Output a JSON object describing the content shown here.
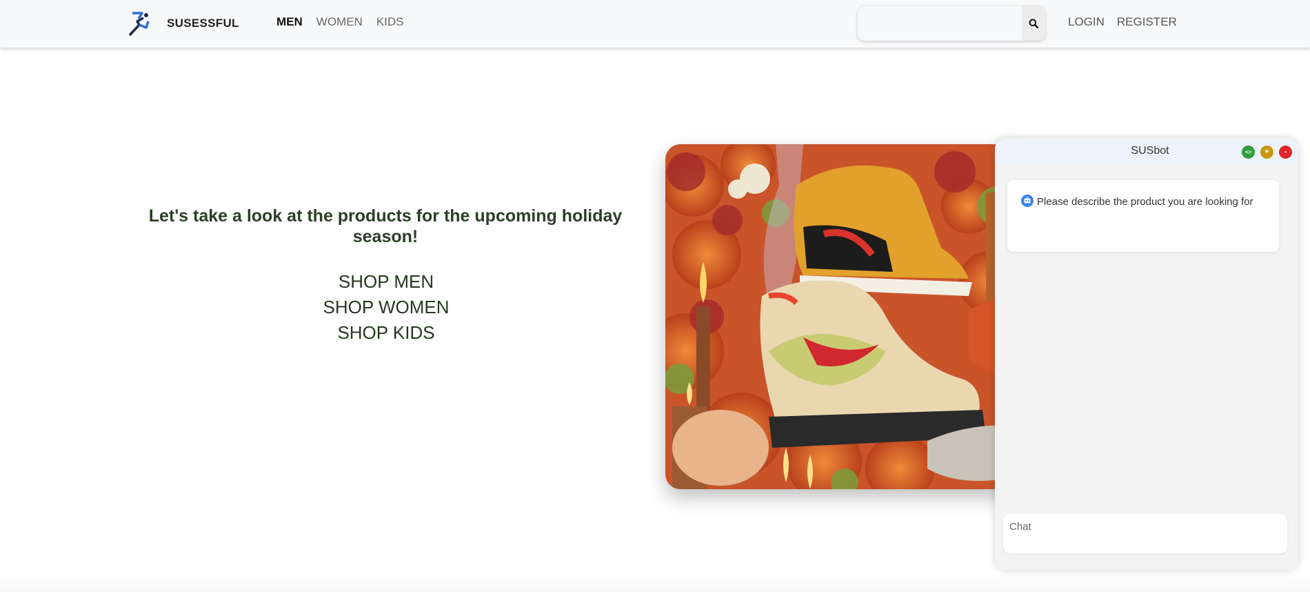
{
  "brand": {
    "name": "SUSESSFUL",
    "logo_icon": "runner-logo-icon"
  },
  "nav": {
    "links": [
      {
        "label": "MEN",
        "active": true
      },
      {
        "label": "WOMEN",
        "active": false
      },
      {
        "label": "KIDS",
        "active": false
      }
    ]
  },
  "search": {
    "value": "",
    "icon": "search-icon"
  },
  "auth": {
    "login": "LOGIN",
    "register": "REGISTER"
  },
  "hero": {
    "title": "Let's take a look at the products for the upcoming holiday season!",
    "shop_links": [
      "SHOP MEN",
      "SHOP WOMEN",
      "SHOP KIDS"
    ],
    "image": "sneakers-on-flowers-photo"
  },
  "chat": {
    "title": "SUSbot",
    "controls": [
      "<>",
      "+",
      "-"
    ],
    "messages": [
      {
        "from": "bot",
        "icon": "robot-avatar-icon",
        "text": "Please describe the product you are looking for"
      }
    ],
    "input_placeholder": "Chat"
  },
  "colors": {
    "navbar_bg": "#f8f9fa",
    "hero_text": "#2b3f27",
    "chat_bg": "#f3f3f3",
    "chat_header_bg": "#eef3fb",
    "ctrl_green": "#2f9e3a",
    "ctrl_yellow": "#c9980e",
    "ctrl_red": "#e0262a"
  }
}
